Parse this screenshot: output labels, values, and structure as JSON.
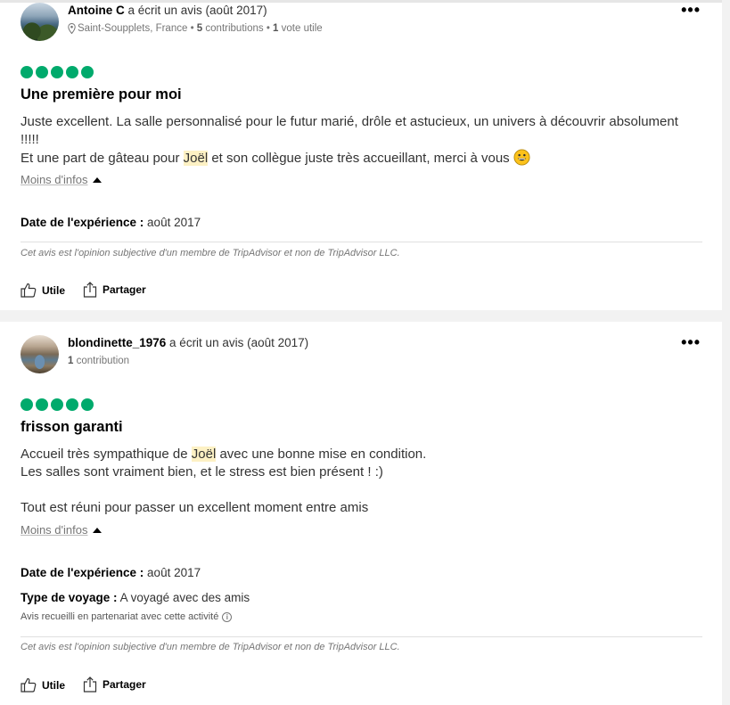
{
  "reviews": [
    {
      "author": "Antoine C",
      "action": "a écrit un avis (août 2017)",
      "location": "Saint-Soupplets, France",
      "contributions_count": "5",
      "contributions_label": "contributions",
      "helpful_count": "1",
      "helpful_label": "vote utile",
      "rating": 5,
      "title": "Une première pour moi",
      "body": {
        "line1": "Juste excellent. La salle personnalisé pour le futur marié, drôle et astucieux, un univers à découvrir absolument !!!!!",
        "line2_before": "Et une part de gâteau pour ",
        "highlight": "Joël",
        "line2_after": " et son collègue juste très accueillant, merci à vous ",
        "emoji": "grinning-face-emoji"
      },
      "less_info": "Moins d'infos",
      "experience_date_label": "Date de l'expérience :",
      "experience_date_value": "août 2017",
      "disclaimer": "Cet avis est l'opinion subjective d'un membre de TripAdvisor et non de TripAdvisor LLC.",
      "helpful_button": "Utile",
      "share_button": "Partager"
    },
    {
      "author": "blondinette_1976",
      "action": "a écrit un avis (août 2017)",
      "contributions_count": "1",
      "contributions_label": "contribution",
      "rating": 5,
      "title": "frisson garanti",
      "body": {
        "line1_before": "Accueil très sympathique de ",
        "highlight": "Joël",
        "line1_after": " avec une bonne mise en condition.",
        "line2": "Les salles sont vraiment bien, et le stress est bien présent ! :)",
        "line3": "Tout est réuni pour passer un excellent moment entre amis"
      },
      "less_info": "Moins d'infos",
      "experience_date_label": "Date de l'expérience :",
      "experience_date_value": "août 2017",
      "trip_type_label": "Type de voyage :",
      "trip_type_value": "A voyagé avec des amis",
      "partner_note": "Avis recueilli en partenariat avec cette activité",
      "disclaimer": "Cet avis est l'opinion subjective d'un membre de TripAdvisor et non de TripAdvisor LLC.",
      "helpful_button": "Utile",
      "share_button": "Partager"
    }
  ],
  "colors": {
    "rating_bubble": "#00aa6c",
    "highlight": "#fdf1c4",
    "separator": "#f2f2f2"
  }
}
